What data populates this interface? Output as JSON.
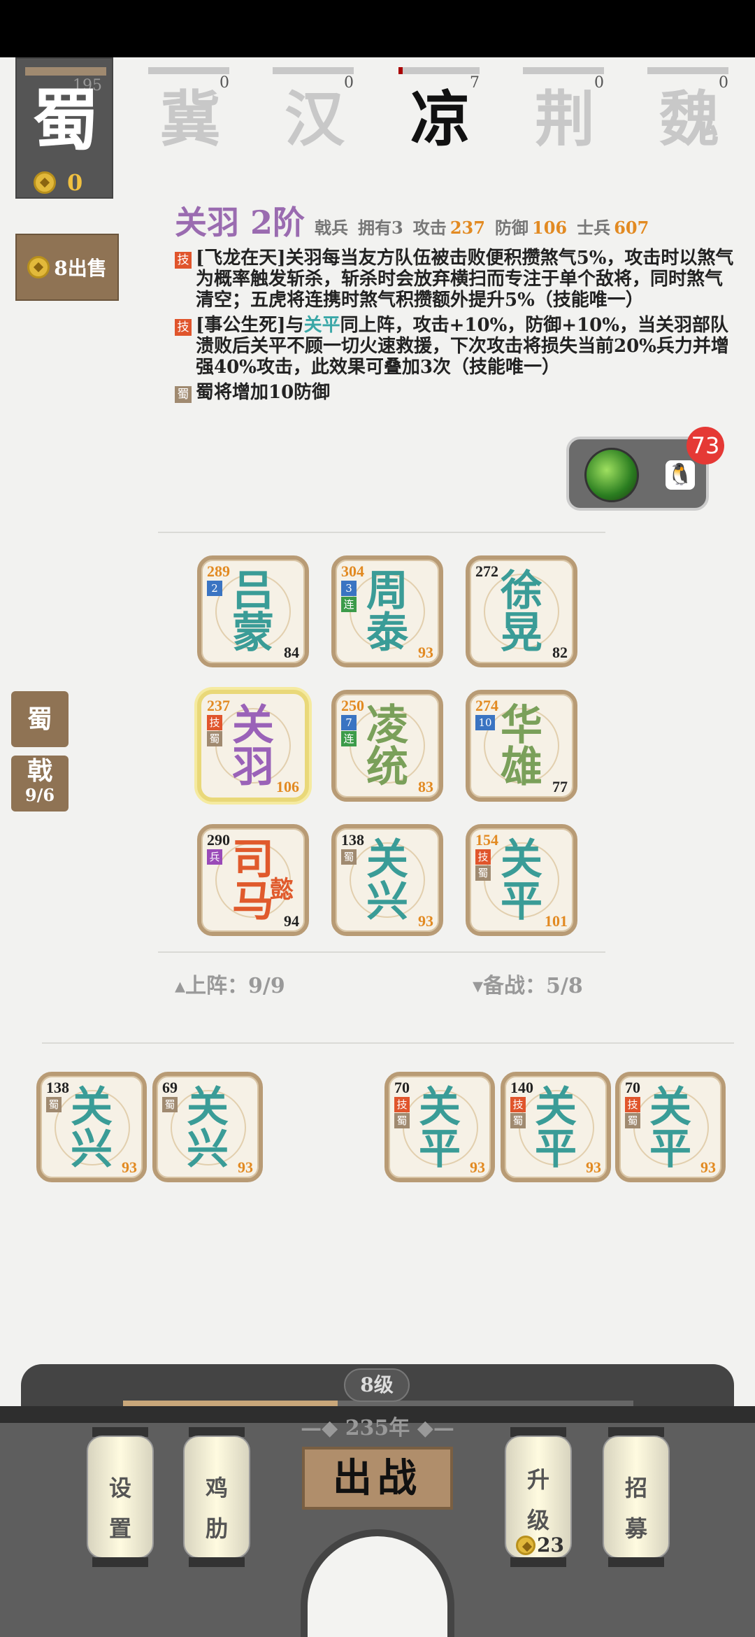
{
  "faction": {
    "count": "195",
    "name": "蜀",
    "gold": "0"
  },
  "kingdoms": [
    {
      "name": "冀",
      "count": "0",
      "progress": 0
    },
    {
      "name": "汉",
      "count": "0",
      "progress": 0
    },
    {
      "name": "凉",
      "count": "7",
      "progress": 0.05
    },
    {
      "name": "荆",
      "count": "0",
      "progress": 0
    },
    {
      "name": "魏",
      "count": "0",
      "progress": 0
    }
  ],
  "sell_button": {
    "label": "8出售"
  },
  "hero": {
    "name": "关羽 2阶",
    "type": "戟兵",
    "owned": "拥有3",
    "attack_label": "攻击",
    "attack": "237",
    "defense_label": "防御",
    "defense": "106",
    "troops_label": "士兵",
    "troops": "607",
    "skill1_tag": "技",
    "skill1_text": "[飞龙在天]关羽每当友方队伍被击败便积攒煞气5%，攻击时以煞气为概率触发斩杀，斩杀时会放弃横扫而专注于单个敌将，同时煞气清空；五虎将连携时煞气积攒额外提升5%（技能唯一）",
    "skill2_tag": "技",
    "skill2_pre": "[事公生死]与",
    "skill2_link": "关平",
    "skill2_post": "同上阵，攻击+10%，防御+10%，当关羽部队溃败后关平不顾一切火速救援，下次攻击将损失当前20%兵力并增强40%攻击，此效果可叠加3次（技能唯一）",
    "bonus_tag": "蜀",
    "bonus_text": "蜀将增加10防御"
  },
  "qq_widget": {
    "badge": "73",
    "icon": "🐧"
  },
  "board": [
    {
      "c1": "吕",
      "c2": "蒙",
      "tl": "289",
      "br": "84",
      "badges": [
        "2"
      ],
      "badge_colors": [
        "blue"
      ],
      "color": "teal",
      "tl_color": "orange",
      "br_color": "dark"
    },
    {
      "c1": "周",
      "c2": "泰",
      "tl": "304",
      "br": "93",
      "badges": [
        "3",
        "连"
      ],
      "badge_colors": [
        "blue",
        "green"
      ],
      "color": "teal",
      "tl_color": "orange",
      "br_color": "orange"
    },
    {
      "c1": "徐",
      "c2": "晃",
      "tl": "272",
      "br": "82",
      "badges": [],
      "badge_colors": [],
      "color": "teal",
      "tl_color": "dark",
      "br_color": "dark"
    },
    {
      "c1": "关",
      "c2": "羽",
      "tl": "237",
      "br": "106",
      "badges": [
        "技",
        "蜀"
      ],
      "badge_colors": [
        "red",
        "shu"
      ],
      "color": "purple",
      "tl_color": "orange",
      "br_color": "orange",
      "selected": true
    },
    {
      "c1": "凌",
      "c2": "统",
      "tl": "250",
      "br": "83",
      "badges": [
        "7",
        "连"
      ],
      "badge_colors": [
        "blue",
        "green"
      ],
      "color": "green",
      "tl_color": "orange",
      "br_color": "orange"
    },
    {
      "c1": "华",
      "c2": "雄",
      "tl": "274",
      "br": "77",
      "badges": [
        "10"
      ],
      "badge_colors": [
        "blue"
      ],
      "color": "green",
      "tl_color": "orange",
      "br_color": "dark"
    },
    {
      "c1": "司",
      "c2": "马",
      "c3": "懿",
      "tl": "290",
      "br": "94",
      "badges": [
        "兵"
      ],
      "badge_colors": [
        "purple"
      ],
      "color": "orange",
      "tl_color": "dark",
      "br_color": "dark"
    },
    {
      "c1": "关",
      "c2": "兴",
      "tl": "138",
      "br": "93",
      "badges": [
        "蜀"
      ],
      "badge_colors": [
        "shu"
      ],
      "color": "teal",
      "tl_color": "dark",
      "br_color": "orange"
    },
    {
      "c1": "关",
      "c2": "平",
      "tl": "154",
      "br": "101",
      "badges": [
        "技",
        "蜀"
      ],
      "badge_colors": [
        "red",
        "shu"
      ],
      "color": "teal",
      "tl_color": "orange",
      "br_color": "orange"
    }
  ],
  "side_tabs": {
    "shu": "蜀",
    "ji": "戟",
    "ji_count": "9/6"
  },
  "deploy_label": "▴上阵：9/9",
  "reserve_label": "▾备战：5/8",
  "reserve": [
    {
      "c1": "关",
      "c2": "兴",
      "tl": "138",
      "br": "93",
      "badges": [
        "蜀"
      ],
      "badge_colors": [
        "shu"
      ]
    },
    {
      "c1": "关",
      "c2": "兴",
      "tl": "69",
      "br": "93",
      "badges": [
        "蜀"
      ],
      "badge_colors": [
        "shu"
      ]
    },
    {
      "c1": "关",
      "c2": "平",
      "tl": "70",
      "br": "93",
      "badges": [
        "技",
        "蜀"
      ],
      "badge_colors": [
        "red",
        "shu"
      ]
    },
    {
      "c1": "关",
      "c2": "平",
      "tl": "140",
      "br": "93",
      "badges": [
        "技",
        "蜀"
      ],
      "badge_colors": [
        "red",
        "shu"
      ]
    },
    {
      "c1": "关",
      "c2": "平",
      "tl": "70",
      "br": "93",
      "badges": [
        "技",
        "蜀"
      ],
      "badge_colors": [
        "red",
        "shu"
      ]
    }
  ],
  "footer": {
    "level": "8级",
    "xp_progress": 0.42,
    "year": "—◆ 235年 ◆—",
    "settings": [
      "设",
      "置"
    ],
    "chicken_rib": [
      "鸡",
      "肋"
    ],
    "battle": "出战",
    "upgrade": [
      "升",
      "级"
    ],
    "upgrade_cost": "23",
    "recruit": [
      "招",
      "募"
    ]
  }
}
